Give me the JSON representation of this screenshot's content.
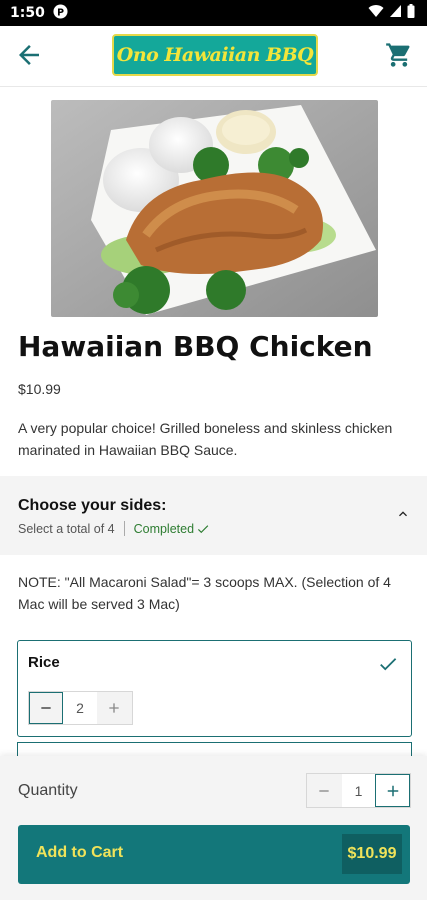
{
  "status_bar": {
    "time": "1:50",
    "icons": [
      "notification-p-icon",
      "wifi-icon",
      "signal-icon",
      "battery-icon"
    ]
  },
  "app_bar": {
    "logo_text": "Ono Hawaiian BBQ",
    "back_icon": "arrow-left-icon",
    "cart_icon": "cart-icon"
  },
  "product": {
    "name": "Hawaiian BBQ Chicken",
    "price": "$10.99",
    "description": "A very popular choice! Grilled boneless and skinless chicken marinated in Hawaiian BBQ Sauce."
  },
  "sides": {
    "title": "Choose your sides:",
    "instruction": "Select a total of 4",
    "status": "Completed",
    "note": "NOTE: \"All Macaroni Salad\"= 3 scoops MAX. (Selection of 4 Mac will be served 3 Mac)",
    "options": [
      {
        "label": "Rice",
        "quantity": "2",
        "selected": true
      }
    ]
  },
  "order": {
    "quantity_label": "Quantity",
    "quantity": "1",
    "add_label": "Add to Cart",
    "total": "$10.99"
  },
  "colors": {
    "brand_teal": "#13777a",
    "accent_yellow": "#f0e35a",
    "success_green": "#2e7d32"
  }
}
